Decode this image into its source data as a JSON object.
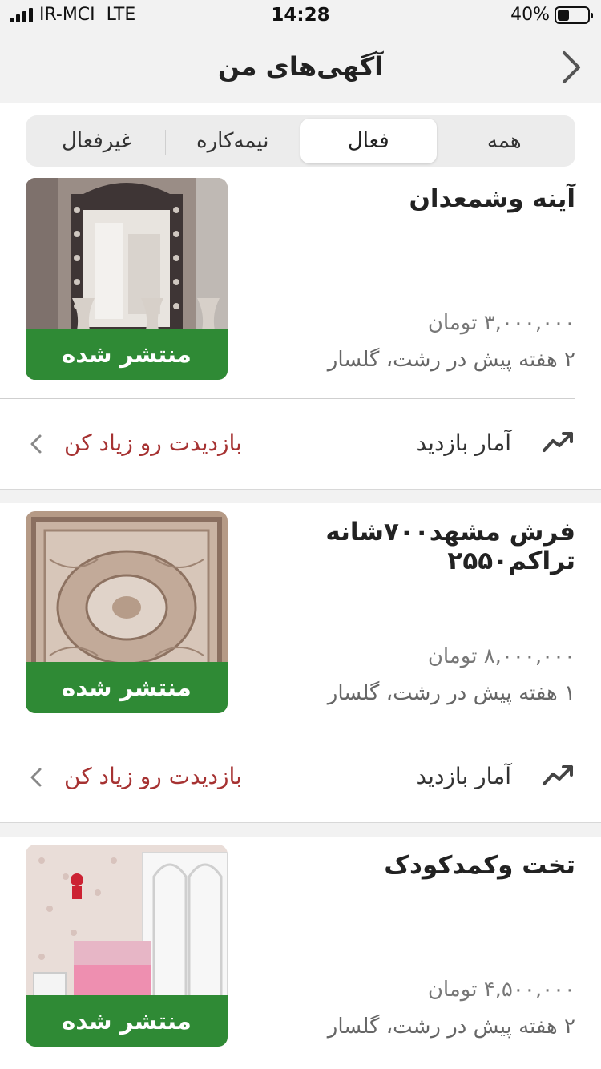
{
  "status": {
    "carrier": "IR-MCI",
    "network": "LTE",
    "time": "14:28",
    "battery": "40%",
    "battery_level": 0.4
  },
  "header": {
    "title": "آگهی‌های من"
  },
  "tabs": [
    {
      "label": "همه"
    },
    {
      "label": "فعال"
    },
    {
      "label": "نیمه‌کاره"
    },
    {
      "label": "غیرفعال"
    }
  ],
  "active_tab": "فعال",
  "listings": [
    {
      "title": "آینه وشمعدان",
      "price": "۳,۰۰۰,۰۰۰ تومان",
      "meta": "۲ هفته پیش در رشت، گلسار",
      "status": "منتشر شده",
      "stats_label": "آمار بازدید",
      "boost_label": "بازدیدت رو زیاد کن"
    },
    {
      "title": "فرش مشهد۷۰۰شانه تراکم۲۵۵۰",
      "price": "۸,۰۰۰,۰۰۰ تومان",
      "meta": "۱ هفته پیش در رشت، گلسار",
      "status": "منتشر شده",
      "stats_label": "آمار بازدید",
      "boost_label": "بازدیدت رو زیاد کن"
    },
    {
      "title": "تخت وکمدکودک",
      "price": "۴,۵۰۰,۰۰۰ تومان",
      "meta": "۲ هفته پیش در رشت، گلسار",
      "status": "منتشر شده"
    }
  ],
  "colors": {
    "badge": "#2f8a35",
    "boost_text": "#a63232",
    "header_bg": "#f2f2f2"
  }
}
